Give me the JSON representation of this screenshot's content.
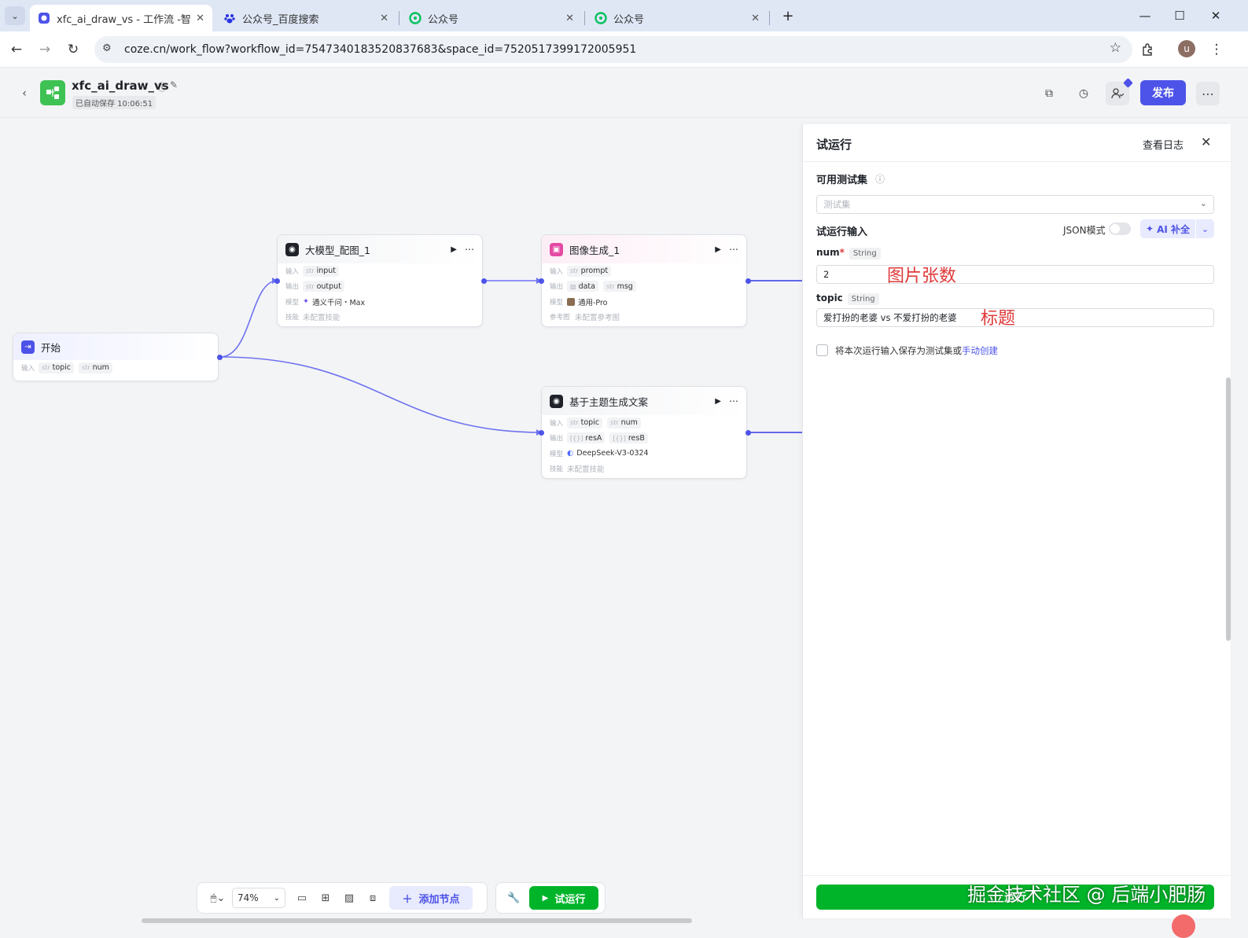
{
  "browser": {
    "tabs": [
      {
        "title": "xfc_ai_draw_vs - 工作流 -智能",
        "icon": "coze-icon",
        "close": "✕"
      },
      {
        "title": "公众号_百度搜索",
        "icon": "baidu-paw-icon",
        "close": "✕"
      },
      {
        "title": "公众号",
        "icon": "wechat-mp-icon",
        "close": "✕"
      },
      {
        "title": "公众号",
        "icon": "wechat-mp-icon",
        "close": "✕"
      }
    ],
    "new_tab": "+",
    "url": "coze.cn/work_flow?workflow_id=7547340183520837683&space_id=7520517399172005951",
    "profile_initial": "u"
  },
  "header": {
    "workflow_name": "xfc_ai_draw_vs",
    "autosave": "已自动保存 10:06:51",
    "publish": "发布"
  },
  "nodes": {
    "start": {
      "title": "开始",
      "in_label": "输入",
      "params": [
        {
          "type": "str",
          "name": "topic"
        },
        {
          "type": "str",
          "name": "num"
        }
      ]
    },
    "llm": {
      "title": "大模型_配图_1",
      "in_label": "输入",
      "input": {
        "type": "str",
        "name": "input"
      },
      "out_label": "输出",
      "output": {
        "type": "str",
        "name": "output"
      },
      "model_label": "模型",
      "model": "通义千问・Max",
      "skill_label": "技能",
      "skill": "未配置技能"
    },
    "image": {
      "title": "图像生成_1",
      "in_label": "输入",
      "input": {
        "type": "str",
        "name": "prompt"
      },
      "out_label": "输出",
      "outputs": [
        "data",
        "msg"
      ],
      "out_types": [
        "img",
        "str"
      ],
      "model_label": "模型",
      "model": "通用-Pro",
      "ref_label": "参考图",
      "ref": "未配置参考图"
    },
    "copy": {
      "title": "基于主题生成文案",
      "in_label": "输入",
      "inputs": [
        {
          "type": "str",
          "name": "topic"
        },
        {
          "type": "str",
          "name": "num"
        }
      ],
      "out_label": "输出",
      "outputs": [
        {
          "type": "[{}]",
          "name": "resA"
        },
        {
          "type": "[{}]",
          "name": "resB"
        }
      ],
      "model_label": "模型",
      "model": "DeepSeek-V3-0324",
      "skill_label": "技能",
      "skill": "未配置技能"
    }
  },
  "toolbar": {
    "zoom": "74%",
    "add_node": "添加节点",
    "test_run": "试运行"
  },
  "panel": {
    "title": "试运行",
    "view_log": "查看日志",
    "testset_label": "可用测试集",
    "testset_placeholder": "测试集",
    "input_title": "试运行输入",
    "json_mode": "JSON模式",
    "ai_fill": "AI 补全",
    "num": {
      "name": "num",
      "required": "*",
      "type": "String",
      "value": "2",
      "annotation": "图片张数"
    },
    "topic": {
      "name": "topic",
      "type": "String",
      "value": "爱打扮的老婆 vs 不爱打扮的老婆",
      "annotation": "标题"
    },
    "save_text": "将本次运行输入保存为测试集或",
    "save_link": "手动创建",
    "run_button": "运行"
  },
  "watermark": "掘金技术社区 @ 后端小肥肠",
  "colors": {
    "accent": "#4d53e8",
    "run_green": "#00b42a",
    "annotation_red": "#e03a3a"
  }
}
